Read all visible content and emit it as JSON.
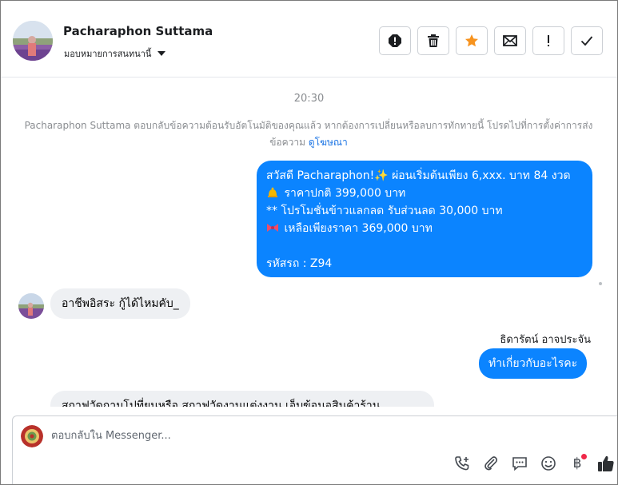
{
  "header": {
    "contact_name": "Pacharaphon Suttama",
    "assign_label": "มอบหมายการสนทนานี้",
    "action_icons": [
      "alert-circle-icon",
      "trash-icon",
      "star-icon",
      "envelope-icon",
      "exclamation-icon",
      "check-icon"
    ]
  },
  "conversation": {
    "timestamp": "20:30",
    "notice_text": "Pacharaphon Suttama ตอบกลับข้อความต้อนรับอัตโนมัติของคุณแล้ว หากต้องการเปลี่ยนหรือลบการทักทายนี้ โปรดไปที่การตั้งค่าการส่งข้อความ",
    "notice_link": "ดูโฆษณา",
    "offer_message": {
      "line1": "สวัสดี Pacharaphon!✨  ผ่อนเริ่มต้นเพียง 6,xxx. บาท 84 งวด",
      "line2": " ราคาปกติ 399,000 บาท",
      "line3": "** โปรโมชั่นข้าวแลกลด รับส่วนลด 30,000 บาท",
      "line4": "  เหลือเพียงราคา 369,000 บาท",
      "line5": " รหัสรถ : Z94"
    },
    "customer_message_1": "อาชีพอิสระ กู้ได้ไหมคับ_",
    "agent_name": "ธิดารัตน์ อาจประจัน",
    "agent_message": "ทำเกี่ยวกับอะไรคะ",
    "customer_message_2": "สถาฟวัดถามโปที่ยนหรือ  สถาฟวัดงานแต่งงาน  เอ็บข้อนอสินค้าร้าน"
  },
  "composer": {
    "placeholder": "ตอบกลับใน Messenger...",
    "tool_icons": [
      "phone-add-icon",
      "paperclip-icon",
      "saved-reply-icon",
      "emoji-icon",
      "baht-payment-icon",
      "thumbs-up-icon"
    ],
    "baht_symbol": "฿"
  },
  "colors": {
    "outgoing_bubble": "#0b84ff",
    "incoming_bubble": "#eef0f3",
    "star_accent": "#f7931e",
    "link": "#1b74e4",
    "badge": "#f02849"
  }
}
